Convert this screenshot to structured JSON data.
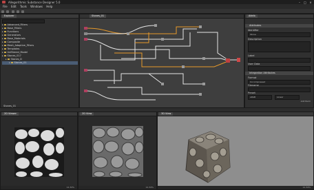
{
  "window": {
    "title": "Allegorithmic Substance Designer 5.0",
    "min": "–",
    "max": "□",
    "close": "×"
  },
  "menu": [
    "File",
    "Edit",
    "Tools",
    "Windows",
    "Help"
  ],
  "explorer": {
    "tab": "Explorer",
    "items": [
      {
        "label": "Advanced_Filters",
        "level": 1
      },
      {
        "label": "Base_Filters",
        "level": 1
      },
      {
        "label": "Functions",
        "level": 1
      },
      {
        "label": "Generators",
        "level": 1
      },
      {
        "label": "Base_Materials",
        "level": 1
      },
      {
        "label": "Composite",
        "level": 1
      },
      {
        "label": "Mesh_Adaptive_Filters",
        "level": 1
      },
      {
        "label": "Templates",
        "level": 1
      },
      {
        "label": "Unfiltered_Model",
        "level": 1
      },
      {
        "label": "Stones_017",
        "level": 1
      },
      {
        "label": "Stones_D",
        "level": 2
      },
      {
        "label": "Stones_01",
        "level": 3
      }
    ],
    "bottom_label": "Stones_01"
  },
  "graph": {
    "tab": "Stones_01"
  },
  "attributes": {
    "tab": "Attrib",
    "section1": "Attributes",
    "identifier_label": "Identifier",
    "identifier_value": "Stone",
    "description_label": "Description",
    "label_label": "Label",
    "user_data_label": "User Data",
    "section2": "Integration Attributes",
    "format_label": "Format",
    "format_value": "Uncompressed",
    "filename_label": "Filename",
    "preset_label": "Preset",
    "preset_value": "sRGB",
    "preset_b": "Linear",
    "add_button": "Add Parm"
  },
  "viewer2d_left": {
    "tab": "2D Viewer",
    "zoom": "12.34%"
  },
  "viewer2d_mid": {
    "tab": "2D View",
    "zoom": "12.34%"
  },
  "viewer3d": {
    "tab": "3D View",
    "zoom": "12.34%"
  },
  "colors": {
    "orange": "#e89a2a",
    "white_link": "#e6e6e6",
    "selection": "#4a5c74"
  }
}
